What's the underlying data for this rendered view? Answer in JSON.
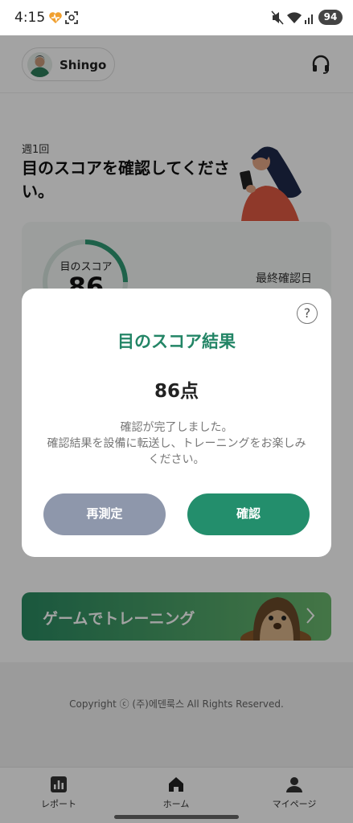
{
  "status_bar": {
    "time": "4:15",
    "battery": "94",
    "icons": [
      "health-heart-icon",
      "screenshot-icon",
      "mute-icon",
      "wifi-icon",
      "signal-icon",
      "battery-icon"
    ]
  },
  "header": {
    "profile_name": "Shingo",
    "support_icon": "headset-icon"
  },
  "eye_card": {
    "frequency": "週1回",
    "title": "目のスコアを確認してください。",
    "score_label": "目のスコア",
    "score_value": "86",
    "last_check_label": "最終確認日"
  },
  "game_banner": {
    "label": "ゲームでトレーニング"
  },
  "footer": {
    "copyright": "Copyright ⓒ (주)에덴룩스 All Rights Reserved."
  },
  "tabs": [
    {
      "label": "レポート",
      "icon": "report-chart-icon"
    },
    {
      "label": "ホーム",
      "icon": "home-icon"
    },
    {
      "label": "マイページ",
      "icon": "person-icon"
    }
  ],
  "modal": {
    "title": "目のスコア結果",
    "score": "86点",
    "message_line1": "確認が完了しました。",
    "message_line2": "確認結果を設備に転送し、トレーニングをお楽しみください。",
    "retest_label": "再測定",
    "confirm_label": "確認",
    "help_label": "?"
  },
  "colors": {
    "accent_green": "#238566",
    "retest_gray": "#8e97ab",
    "confirm_green": "#238e6c"
  }
}
